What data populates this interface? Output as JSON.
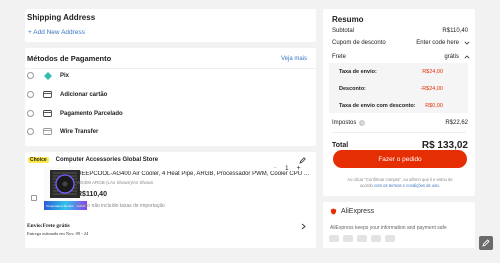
{
  "shipping": {
    "title": "Shipping Address",
    "add_label": "+ Add New Address"
  },
  "payment": {
    "title": "Métodos de Pagamento",
    "see_more": "Veja mais",
    "methods": [
      {
        "label": "Pix",
        "icon": "pix-icon"
      },
      {
        "label": "Adicionar cartão",
        "icon": "card-icon"
      },
      {
        "label": "Pagamento Parcelado",
        "icon": "card-icon"
      },
      {
        "label": "Wire Transfer",
        "icon": "bank-icon"
      }
    ]
  },
  "store": {
    "badge": "Choice",
    "name": "Computer Accessories Global Store",
    "product_title": "DEEPCOOL-AG400 Air Cooler, 4 Heat Pipe, ARGB, Processador PWM, Cooler CPU para LGA...",
    "variant": "AG400 ARGB (LAs Shown)/As Shown",
    "price": "R$110,40",
    "tax_note": "Preço não incluído taxas de importação",
    "quantity": "1",
    "shipping_title": "Envio:Frete grátis",
    "delivery": "Entrega estimada em Nov. 09 - 24",
    "image_labels": [
      "Temperature Monitor",
      "ARGB"
    ]
  },
  "summary": {
    "title": "Resumo",
    "subtotal_label": "Subtotal",
    "subtotal_value": "R$110,40",
    "coupon_label": "Cupom de desconto",
    "coupon_value": "Enter code here",
    "frete_label": "Frete",
    "frete_value": "grátis",
    "tax_label": "Taxa de envio:",
    "tax_value": "R$24,00",
    "discount_label": "Desconto:",
    "discount_value": "-R$24,00",
    "tax_discount_label": "Taxa de envio com desconto:",
    "tax_discount_value": "R$0,00",
    "impostos_label": "Impostos",
    "impostos_value": "R$22,62",
    "total_label": "Total",
    "total_value": "R$ 133,02",
    "button_label": "Fazer o pedido",
    "legal_1": "Ao clicar \"Confirmar compra\", eu afirmo que li e estou de",
    "legal_2a": "acordo ",
    "legal_2b": "com os termos e condições de uso."
  },
  "aliexpress": {
    "brand": "AliExpress",
    "description": "AliExpress keeps your information and payment safe"
  },
  "colors": {
    "accent": "#e62e04",
    "link": "#3a75c4",
    "pix": "#32bcad"
  }
}
